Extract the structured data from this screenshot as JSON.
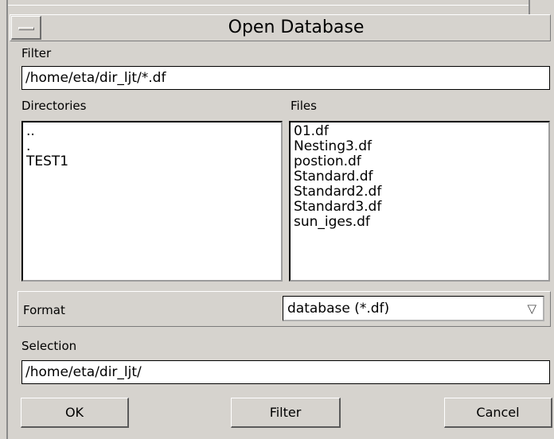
{
  "window": {
    "title": "Open Database"
  },
  "filter": {
    "label": "Filter",
    "value": "/home/eta/dir_ljt/*.df"
  },
  "directories": {
    "label": "Directories",
    "items": [
      "..",
      ".",
      "TEST1"
    ]
  },
  "files": {
    "label": "Files",
    "items": [
      "01.df",
      "Nesting3.df",
      "postion.df",
      "Standard.df",
      "Standard2.df",
      "Standard3.df",
      "sun_iges.df"
    ]
  },
  "format": {
    "label": "Format",
    "selected": "database (*.df)"
  },
  "selection": {
    "label": "Selection",
    "value": "/home/eta/dir_ljt/"
  },
  "buttons": {
    "ok": "OK",
    "filter": "Filter",
    "cancel": "Cancel"
  }
}
